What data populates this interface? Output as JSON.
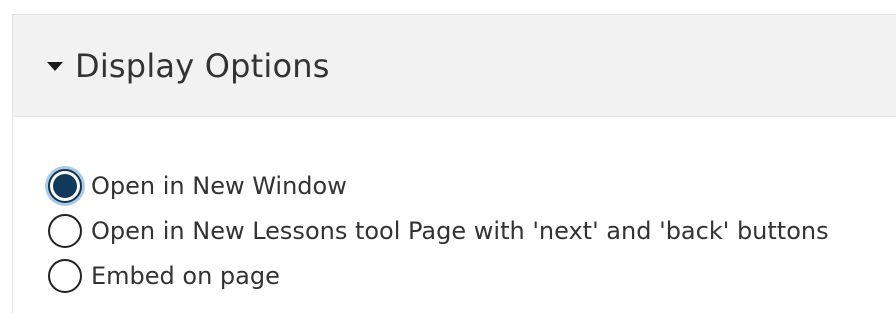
{
  "panel": {
    "title": "Display Options",
    "caret_icon": "caret-down-icon",
    "expanded": true
  },
  "display_options": [
    {
      "label": "Open in New Window",
      "checked": true
    },
    {
      "label": "Open in New Lessons tool Page with 'next' and 'back' buttons",
      "checked": false
    },
    {
      "label": "Embed on page",
      "checked": false
    }
  ],
  "colors": {
    "header_background": "#f2f2f2",
    "selected_radio": "#0f3a5c",
    "focus_ring": "#a9cce8",
    "text": "#333333"
  }
}
